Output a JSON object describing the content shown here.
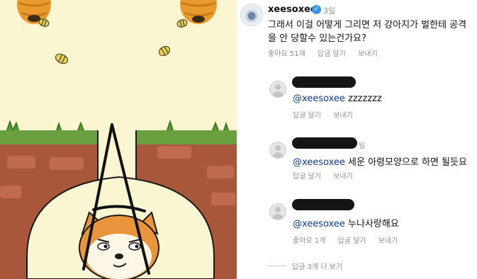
{
  "colors": {
    "sky": "#fbf6d2",
    "grass": "#6aa040",
    "dirt": "#a8573a",
    "brick": "#c06a50",
    "tunnel": "#fbf6d2",
    "hive": "#e99a2c",
    "bee": "#e7d45a",
    "shiba": "#e8953b",
    "mention": "#0b3d91",
    "meta_gray": "#8e8e8e",
    "verified_blue": "#3797f0"
  },
  "game": {
    "scene": "shiba-in-tunnel-with-drawn-lines-protecting-from-bees",
    "icons": [
      "beehive-icon",
      "bee-icon",
      "shiba-dog-icon"
    ]
  },
  "main_comment": {
    "avatar_icon": "blue-eye-avatar-icon",
    "username": "xeesoxee",
    "verified_icon": "verified-badge-icon",
    "verified_glyph": "✓",
    "time": "3일",
    "text": "그래서 이걸 어떻게 그리면 저 강아지가 벌한테 공격을 안 당할수 있는건가요?",
    "likes": "좋아요 51개",
    "reply": "답글 달기",
    "send": "보내기"
  },
  "replies": [
    {
      "avatar_icon": "default-avatar-icon",
      "mention": "@xeesoxee",
      "text": " zzzzzzz",
      "likes": "",
      "reply": "답글 달기",
      "send": "보내기",
      "time": ""
    },
    {
      "avatar_icon": "default-avatar-icon",
      "mention": "@xeesoxee",
      "text": " 세운 아령모양으로 하면 될듯요",
      "likes": "",
      "reply": "답글 달기",
      "send": "보내기",
      "time": "일"
    },
    {
      "avatar_icon": "default-avatar-icon",
      "mention": "@xeesoxee",
      "text": " 누나사랑해요",
      "likes": "좋아요 1개",
      "reply": "답글 달기",
      "send": "보내기",
      "time": ""
    }
  ],
  "more_replies": "답글 3개 더 보기"
}
